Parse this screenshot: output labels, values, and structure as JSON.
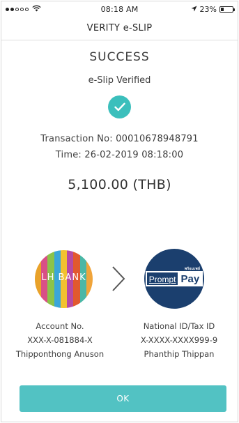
{
  "status_bar": {
    "time": "08:18 AM",
    "battery_percent": "23%",
    "battery_level": 0.23,
    "signal_icon": "signal-dots-icon",
    "wifi_icon": "wifi-icon",
    "location_icon": "location-arrow-icon"
  },
  "nav": {
    "title": "VERITY e-SLIP"
  },
  "result": {
    "status": "SUCCESS",
    "subtitle": "e-Slip Verified",
    "check_icon": "check-icon",
    "check_color": "#3bbfbc",
    "transaction_line": "Transaction No: 00010678948791",
    "time_line": "Time: 26-02-2019 08:18:00",
    "amount": "5,100.00 (THB)"
  },
  "sender": {
    "logo_text": "LH BANK",
    "label": "Account No.",
    "account": "XXX-X-081884-X",
    "name": "Thipponthong Anuson"
  },
  "receiver": {
    "logo_text_prompt": "Prompt",
    "logo_text_pay": "Pay",
    "logo_small": "พร้อมเพย์",
    "logo_color": "#1b3f6e",
    "label": "National ID/Tax ID",
    "account": "X-XXXX-XXXX999-9",
    "name": "Phanthip Thippan"
  },
  "actions": {
    "ok_label": "OK",
    "ok_color": "#52c2c3"
  }
}
